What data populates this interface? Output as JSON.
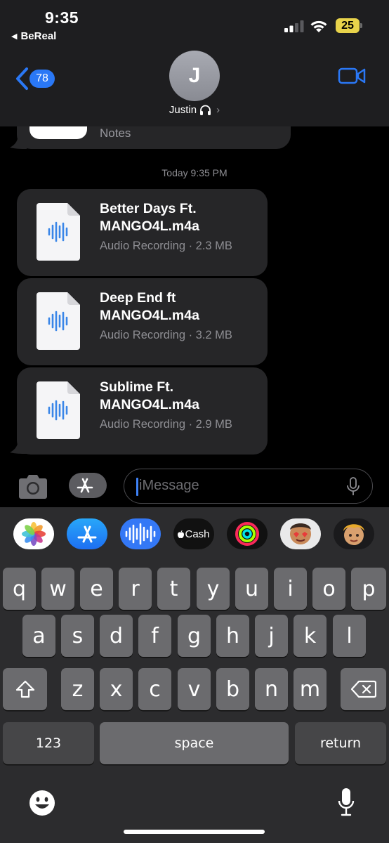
{
  "status_bar": {
    "time": "9:35",
    "back_app": "BeReal",
    "battery_level": "25"
  },
  "header": {
    "back_badge": "78",
    "avatar_initial": "J",
    "contact_name": "Justin",
    "contact_chevron": "›"
  },
  "thread": {
    "previous_attachment_label": "Notes",
    "timestamp": "Today 9:35 PM",
    "attachments": [
      {
        "name": "Better Days Ft. MANGO4L.m4a",
        "meta": "Audio Recording · 2.3 MB"
      },
      {
        "name": "Deep End ft MANGO4L.m4a",
        "meta": "Audio Recording · 3.2 MB"
      },
      {
        "name": "Sublime Ft. MANGO4L.m4a",
        "meta": "Audio Recording · 2.9 MB"
      }
    ]
  },
  "composer": {
    "placeholder": "iMessage"
  },
  "app_strip": {
    "cash_label": "Cash",
    "apps": [
      "photos-app",
      "app-store",
      "audio-message",
      "apple-cash",
      "activity",
      "memoji-stickers",
      "memoji"
    ]
  },
  "keyboard": {
    "row1": [
      "q",
      "w",
      "e",
      "r",
      "t",
      "y",
      "u",
      "i",
      "o",
      "p"
    ],
    "row2": [
      "a",
      "s",
      "d",
      "f",
      "g",
      "h",
      "j",
      "k",
      "l"
    ],
    "row3": [
      "z",
      "x",
      "c",
      "v",
      "b",
      "n",
      "m"
    ],
    "numbers_key": "123",
    "space_key": "space",
    "return_key": "return"
  },
  "colors": {
    "accent": "#2a78f6",
    "bubble": "#262628",
    "keyboard_bg": "#2c2c2e",
    "key": "#6b6b6e",
    "battery": "#e8d34b"
  }
}
